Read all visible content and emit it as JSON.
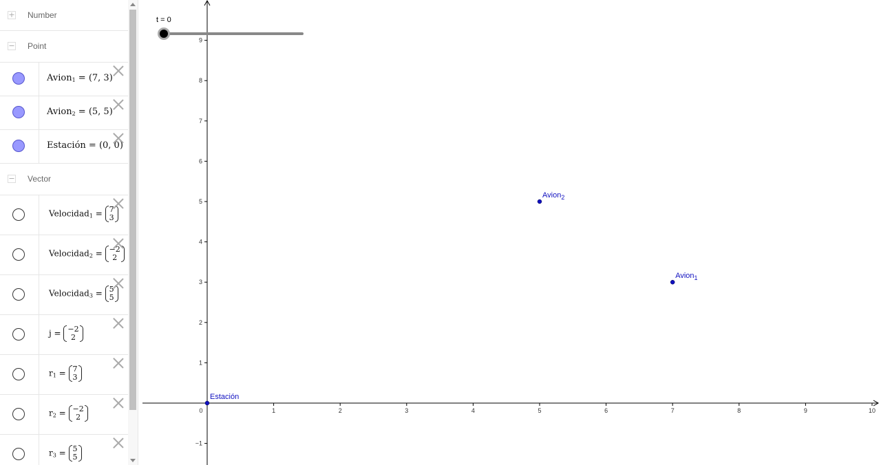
{
  "algebra": {
    "categories": {
      "number": {
        "name": "Number",
        "toggle": "+"
      },
      "point": {
        "name": "Point",
        "toggle": "−"
      },
      "vector": {
        "name": "Vector",
        "toggle": "−"
      }
    },
    "points": [
      {
        "name": "Avion",
        "sub": "1",
        "value": "= (7, 3)"
      },
      {
        "name": "Avion",
        "sub": "2",
        "value": "= (5, 5)"
      },
      {
        "name": "Estación",
        "sub": "",
        "value": "= (0, 0)"
      }
    ],
    "vectors": [
      {
        "name": "Velocidad",
        "sub": "1",
        "eq": "=",
        "top": "7",
        "bottom": "3"
      },
      {
        "name": "Velocidad",
        "sub": "2",
        "eq": "=",
        "top": "−2",
        "bottom": "2"
      },
      {
        "name": "Velocidad",
        "sub": "3",
        "eq": "=",
        "top": "5",
        "bottom": "5"
      },
      {
        "name": "j",
        "sub": "",
        "eq": "=",
        "top": "−2",
        "bottom": "2"
      },
      {
        "name": "r",
        "sub": "1",
        "eq": "=",
        "top": "7",
        "bottom": "3"
      },
      {
        "name": "r",
        "sub": "2",
        "eq": "=",
        "top": "−2",
        "bottom": "2"
      },
      {
        "name": "r",
        "sub": "3",
        "eq": "=",
        "top": "5",
        "bottom": "5"
      }
    ]
  },
  "graphics": {
    "slider": {
      "label": "t = 0",
      "value": 0
    },
    "x_ticks": [
      "0",
      "1",
      "2",
      "3",
      "4",
      "5",
      "6",
      "7",
      "8",
      "9",
      "10"
    ],
    "y_ticks": [
      "9",
      "8",
      "7",
      "6",
      "5",
      "4",
      "3",
      "2",
      "1",
      "−1"
    ],
    "points": [
      {
        "label": "Avion",
        "sub": "2",
        "x": 5,
        "y": 5
      },
      {
        "label": "Avion",
        "sub": "1",
        "x": 7,
        "y": 3
      },
      {
        "label": "Estación",
        "sub": "",
        "x": 0,
        "y": 0
      }
    ],
    "point_color": "#1010c0"
  }
}
